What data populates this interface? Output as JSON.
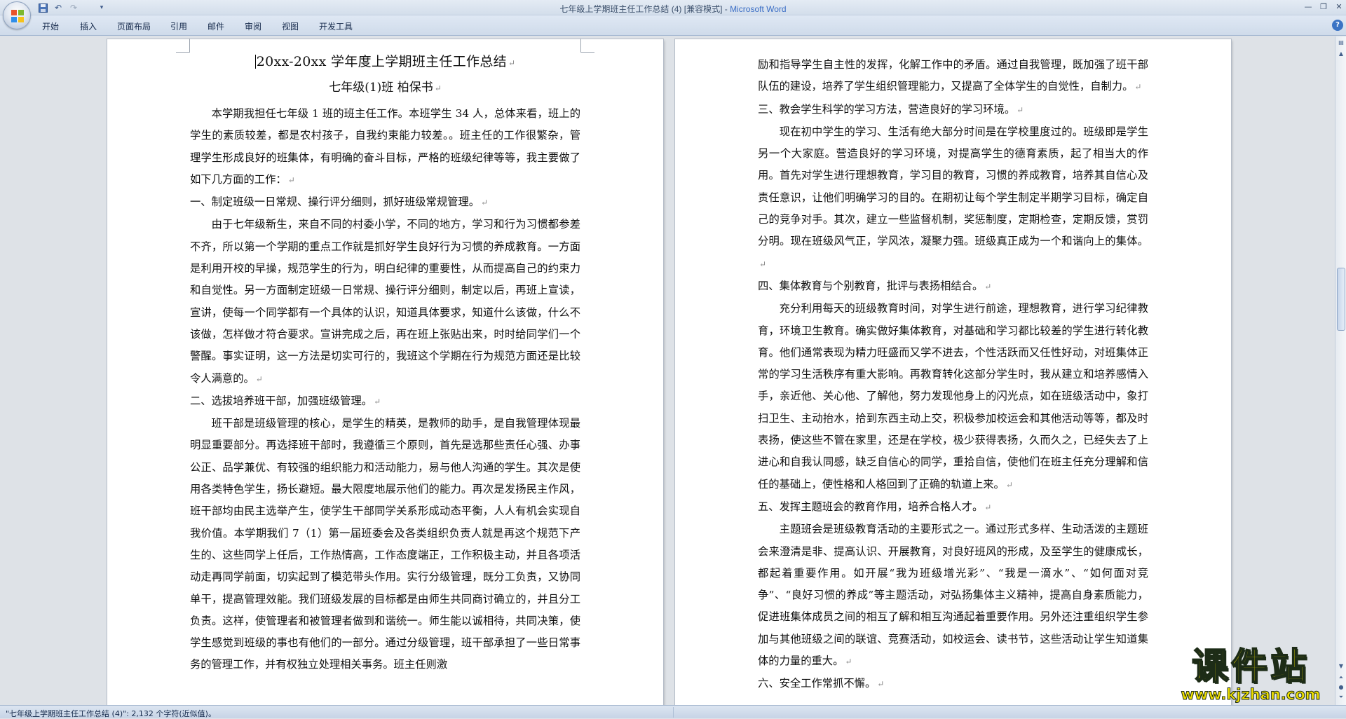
{
  "window": {
    "title_doc": "七年级上学期班主任工作总结 (4) [兼容模式]",
    "title_sep": " - ",
    "title_app": "Microsoft Word"
  },
  "quick_access": {
    "save_icon": "save-icon",
    "undo_icon": "undo-icon",
    "redo_icon": "redo-icon",
    "customize_icon": "customize-icon"
  },
  "ribbon": {
    "tabs": [
      "开始",
      "插入",
      "页面布局",
      "引用",
      "邮件",
      "审阅",
      "视图",
      "开发工具"
    ],
    "help": "?"
  },
  "document": {
    "title": "20xx-20xx 学年度上学期班主任工作总结",
    "subtitle": "七年级(1)班 柏保书",
    "left_paragraphs": [
      {
        "text": "本学期我担任七年级 1 班的班主任工作。本班学生 34 人，总体来看，班上的学生的素质较差，都是农村孩子，自我约束能力较差。。班主任的工作很繁杂，管理学生形成良好的班集体，有明确的奋斗目标，严格的班级纪律等等，我主要做了如下几方面的工作：",
        "indent": true
      },
      {
        "text": "一、制定班级一日常规、操行评分细则，抓好班级常规管理。",
        "indent": false
      },
      {
        "text": "由于七年级新生，来自不同的村委小学，不同的地方，学习和行为习惯都参差不齐，所以第一个学期的重点工作就是抓好学生良好行为习惯的养成教育。一方面是利用开校的早操，规范学生的行为，明白纪律的重要性，从而提高自己的约束力和自觉性。另一方面制定班级一日常规、操行评分细则，制定以后，再班上宣读，宣讲，使每一个同学都有一个具体的认识，知道具体要求，知道什么该做，什么不该做，怎样做才符合要求。宣讲完成之后，再在班上张贴出来，时时给同学们一个警醒。事实证明，这一方法是切实可行的，我班这个学期在行为规范方面还是比较令人满意的。",
        "indent": true
      },
      {
        "text": "二、选拔培养班干部，加强班级管理。",
        "indent": false
      },
      {
        "text": "班干部是班级管理的核心，是学生的精英，是教师的助手，是自我管理体现最明显重要部分。再选择班干部时，我遵循三个原则，首先是选那些责任心强、办事公正、品学兼优、有较强的组织能力和活动能力，易与他人沟通的学生。其次是使用各类特色学生，扬长避短。最大限度地展示他们的能力。再次是发扬民主作风，班干部均由民主选举产生，使学生干部同学关系形成动态平衡，人人有机会实现自我价值。本学期我们 7（1）第一届班委会及各类组织负责人就是再这个规范下产生的、这些同学上任后，工作热情高，工作态度端正，工作积极主动，并且各项活动走再同学前面，切实起到了模范带头作用。实行分级管理，既分工负责，又协同单干，提高管理效能。我们班级发展的目标都是由师生共同商讨确立的，并且分工负责。这样，使管理者和被管理者做到和谐统一。师生能以诚相待，共同决策，使学生感觉到班级的事也有他们的一部分。通过分级管理，班干部承担了一些日常事务的管理工作，并有权独立处理相关事务。班主任则激",
        "indent": true,
        "no_mark": true
      }
    ],
    "right_paragraphs": [
      {
        "text": "励和指导学生自主性的发挥，化解工作中的矛盾。通过自我管理，既加强了班干部队伍的建设，培养了学生组织管理能力，又提高了全体学生的自觉性，自制力。",
        "indent": false
      },
      {
        "text": "三、教会学生科学的学习方法，营造良好的学习环境。",
        "indent": false
      },
      {
        "text": "现在初中学生的学习、生活有绝大部分时间是在学校里度过的。班级即是学生另一个大家庭。营造良好的学习环境，对提高学生的德育素质，起了相当大的作用。首先对学生进行理想教育，学习目的教育，习惯的养成教育，培养其自信心及责任意识，让他们明确学习的目的。在期初让每个学生制定半期学习目标，确定自己的竞争对手。其次，建立一些监督机制，奖惩制度，定期检查，定期反馈，赏罚分明。现在班级风气正，学风浓，凝聚力强。班级真正成为一个和谐向上的集体。",
        "indent": true
      },
      {
        "text": "四、集体教育与个别教育，批评与表扬相结合。",
        "indent": false
      },
      {
        "text": "充分利用每天的班级教育时间，对学生进行前途，理想教育，进行学习纪律教育，环境卫生教育。确实做好集体教育，对基础和学习都比较差的学生进行转化教育。他们通常表现为精力旺盛而又学不进去，个性活跃而又任性好动，对班集体正常的学习生活秩序有重大影响。再教育转化这部分学生时，我从建立和培养感情入手，亲近他、关心他、了解他，努力发现他身上的闪光点，如在班级活动中，象打扫卫生、主动抬水，拾到东西主动上交，积极参加校运会和其他活动等等，都及时表扬，使这些不管在家里，还是在学校，极少获得表扬，久而久之，已经失去了上进心和自我认同感，缺乏自信心的同学，重拾自信，使他们在班主任充分理解和信任的基础上，使性格和人格回到了正确的轨道上来。",
        "indent": true
      },
      {
        "text": "五、发挥主题班会的教育作用，培养合格人才。",
        "indent": false
      },
      {
        "text": "主题班会是班级教育活动的主要形式之一。通过形式多样、生动活泼的主题班会来澄清是非、提高认识、开展教育，对良好班风的形成，及至学生的健康成长，都起着重要作用。如开展“我为班级增光彩”、“我是一滴水”、“如何面对竞争”、“良好习惯的养成”等主题活动，对弘扬集体主义精神，提高自身素质能力，促进班集体成员之间的相互了解和相互沟通起着重要作用。另外还注重组织学生参加与其他班级之间的联谊、竞赛活动，如校运会、读书节，这些活动让学生知道集体的力量的重大。",
        "indent": true
      },
      {
        "text": "六、安全工作常抓不懈。",
        "indent": false
      }
    ],
    "paragraph_mark": "↵"
  },
  "status": {
    "text": "\"七年级上学期班主任工作总结 (4)\": 2,132 个字符(近似值)。"
  },
  "watermark": {
    "name": "课件站",
    "url": "www.kjzhan.com"
  }
}
